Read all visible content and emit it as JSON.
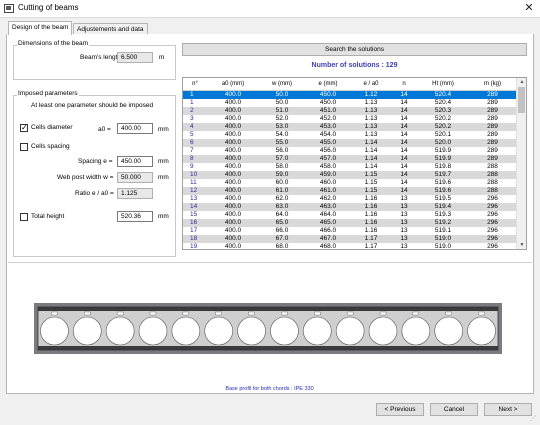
{
  "window": {
    "title": "Cutting of beams",
    "close_glyph": "✕",
    "icon": "window-icon"
  },
  "tabs": [
    {
      "label": "Design of the beam",
      "active": true
    },
    {
      "label": "Adjustements and data",
      "active": false
    }
  ],
  "dimensions": {
    "group_title": "Dimensions of the beam",
    "length_label": "Beam's length",
    "length_value": "6.500",
    "length_unit": "m"
  },
  "imposed": {
    "group_title": "Imposed parameters",
    "hint": "At least one parameter should be imposed",
    "cells_diameter": {
      "label": "Cells diameter",
      "checked": true,
      "check_glyph": "✓",
      "var_label": "a0 =",
      "value": "400.00",
      "unit": "mm"
    },
    "cells_spacing": {
      "label": "Cells spacing",
      "checked": false
    },
    "spacing": {
      "label": "Spacing e =",
      "value": "450.00",
      "unit": "mm"
    },
    "web_post": {
      "label": "Web post width w =",
      "value": "50.000",
      "unit": "mm"
    },
    "ratio": {
      "label": "Ratio e / a0 =",
      "value": "1.125"
    },
    "total_height": {
      "label": "Total height",
      "checked": false,
      "value": "520.36",
      "unit": "mm"
    }
  },
  "search_button": "Search the solutions",
  "solutions_text": "Number of solutions : 129",
  "table": {
    "columns": [
      "n°",
      "a0 (mm)",
      "w (mm)",
      "e (mm)",
      "e / a0",
      "n",
      "Ht (mm)",
      "m (kg)"
    ],
    "selected_row": 0,
    "rows": [
      [
        "1",
        "400.0",
        "50.0",
        "450.0",
        "1.12",
        "14",
        "520.4",
        "289"
      ],
      [
        "1",
        "400.0",
        "50.0",
        "450.0",
        "1.13",
        "14",
        "520.4",
        "289"
      ],
      [
        "2",
        "400.0",
        "51.0",
        "451.0",
        "1.13",
        "14",
        "520.3",
        "289"
      ],
      [
        "3",
        "400.0",
        "52.0",
        "452.0",
        "1.13",
        "14",
        "520.2",
        "289"
      ],
      [
        "4",
        "400.0",
        "53.0",
        "453.0",
        "1.13",
        "14",
        "520.2",
        "289"
      ],
      [
        "5",
        "400.0",
        "54.0",
        "454.0",
        "1.13",
        "14",
        "520.1",
        "289"
      ],
      [
        "6",
        "400.0",
        "55.0",
        "455.0",
        "1.14",
        "14",
        "520.0",
        "289"
      ],
      [
        "7",
        "400.0",
        "56.0",
        "456.0",
        "1.14",
        "14",
        "519.9",
        "289"
      ],
      [
        "8",
        "400.0",
        "57.0",
        "457.0",
        "1.14",
        "14",
        "519.9",
        "289"
      ],
      [
        "9",
        "400.0",
        "58.0",
        "458.0",
        "1.14",
        "14",
        "519.8",
        "288"
      ],
      [
        "10",
        "400.0",
        "59.0",
        "459.0",
        "1.15",
        "14",
        "519.7",
        "288"
      ],
      [
        "11",
        "400.0",
        "60.0",
        "460.0",
        "1.15",
        "14",
        "519.6",
        "288"
      ],
      [
        "12",
        "400.0",
        "61.0",
        "461.0",
        "1.15",
        "14",
        "519.6",
        "288"
      ],
      [
        "13",
        "400.0",
        "62.0",
        "462.0",
        "1.16",
        "13",
        "519.5",
        "296"
      ],
      [
        "14",
        "400.0",
        "63.0",
        "463.0",
        "1.16",
        "13",
        "519.4",
        "296"
      ],
      [
        "15",
        "400.0",
        "64.0",
        "464.0",
        "1.16",
        "13",
        "519.3",
        "296"
      ],
      [
        "16",
        "400.0",
        "65.0",
        "465.0",
        "1.16",
        "13",
        "519.2",
        "296"
      ],
      [
        "17",
        "400.0",
        "66.0",
        "466.0",
        "1.16",
        "13",
        "519.1",
        "296"
      ],
      [
        "18",
        "400.0",
        "67.0",
        "467.0",
        "1.17",
        "13",
        "519.0",
        "296"
      ],
      [
        "19",
        "400.0",
        "68.0",
        "468.0",
        "1.17",
        "13",
        "519.0",
        "296"
      ]
    ]
  },
  "scrollbar": {
    "up_glyph": "▲",
    "down_glyph": "▼"
  },
  "beam_preview": {
    "cells": 14,
    "frame_color": "#7a7a80",
    "web_color": "#cfcfcf",
    "hole_color": "#ffffff",
    "top_chord_color": "#3b3b3b"
  },
  "profile_caption": "Base profil for both chords : IPE 330",
  "buttons": {
    "previous": "< Previous",
    "cancel": "Cancel",
    "next": "Next >"
  },
  "resize_glyph": "⋰",
  "colors": {
    "accent": "#0078d7",
    "link_blue": "#2a2ab0",
    "row_alt": "#d9d9d9"
  }
}
